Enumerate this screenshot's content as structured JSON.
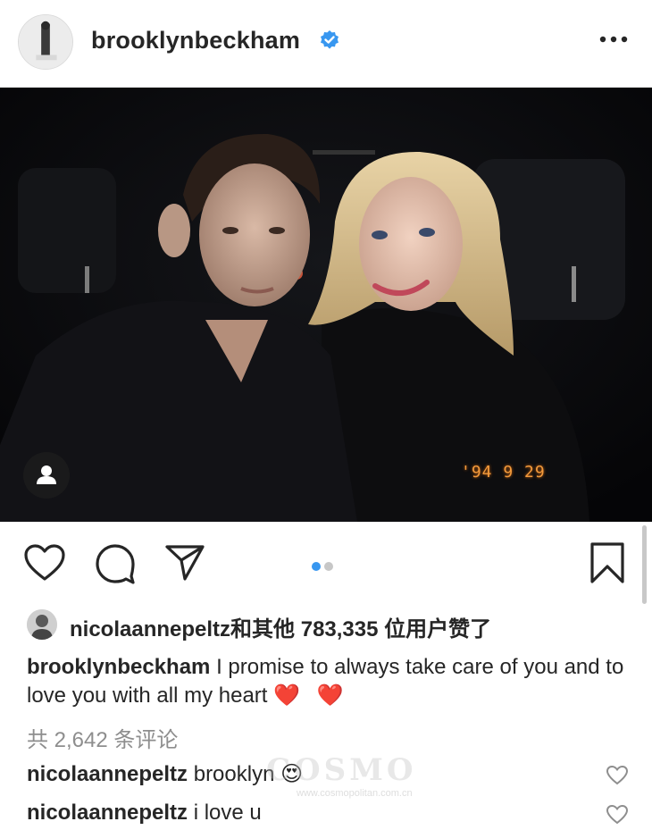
{
  "header": {
    "username": "brooklynbeckham",
    "verified_icon": "verified-badge-icon",
    "more_icon": "more-options-icon",
    "accent": "#3897f0"
  },
  "photo": {
    "date_stamp": "'94 9 29",
    "tag_icon": "user-tag-icon",
    "stamp_color": "#f39a3c"
  },
  "actions": {
    "like_icon": "heart-outline-icon",
    "comment_icon": "comment-bubble-icon",
    "share_icon": "paper-plane-icon",
    "save_icon": "bookmark-icon",
    "carousel": {
      "total": 2,
      "current": 1,
      "active_color": "#3897f0",
      "inactive_color": "#c7c7c7"
    }
  },
  "likes": {
    "first_user": "nicolaannepeltz",
    "rest": "和其他",
    "count": "783,335",
    "suffix": "位用户赞了"
  },
  "caption": {
    "user": "brooklynbeckham",
    "text": "I promise to always take care of you and to love you with all my heart",
    "emoji": "❤️ ❤️"
  },
  "comments_count": "共 2,642 条评论",
  "comments": [
    {
      "user": "nicolaannepeltz",
      "text": "brooklyn 😍"
    },
    {
      "user": "nicolaannepeltz",
      "text": "i love u"
    }
  ],
  "watermark": "COSMO",
  "watermark_sub": "www.cosmopolitan.com.cn"
}
